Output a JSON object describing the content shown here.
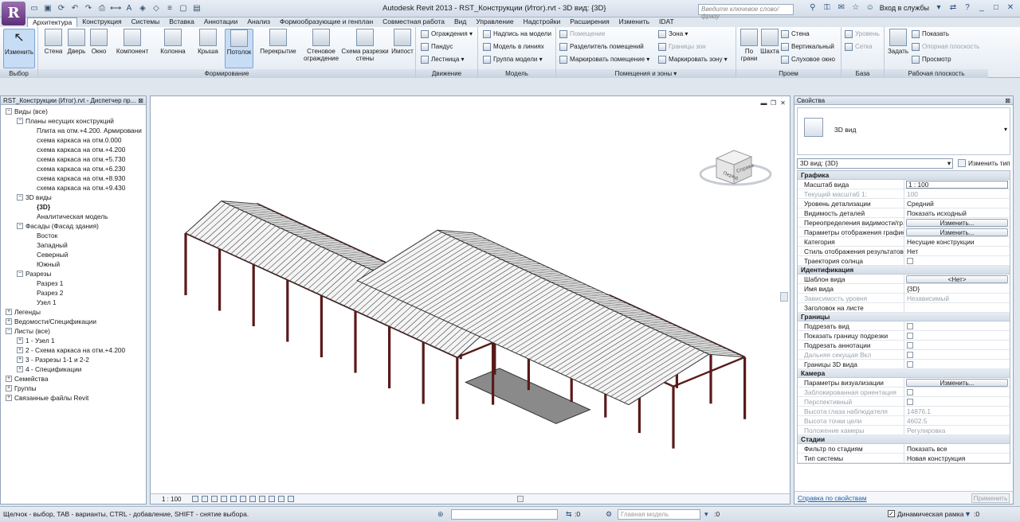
{
  "app": {
    "logo_letter": "R",
    "window_title": "Autodesk Revit 2013 -    RST_Конструкции (Итог).rvt - 3D вид: {3D}",
    "search_placeholder": "Введите ключевое слово/фразу",
    "signin": "Вход в службы"
  },
  "tabs": [
    "Архитектура",
    "Конструкция",
    "Системы",
    "Вставка",
    "Аннотации",
    "Анализ",
    "Формообразующие и генплан",
    "Совместная работа",
    "Вид",
    "Управление",
    "Надстройки",
    "Расширения",
    "Изменить",
    "IDAT"
  ],
  "ribbon": {
    "select": {
      "label": "Выбор",
      "modify": "Изменить"
    },
    "build": {
      "label": "Формирование",
      "tools": [
        "Стена",
        "Дверь",
        "Окно",
        "Компонент",
        "Колонна",
        "Крыша",
        "Потолок",
        "Перекрытие",
        "Стеновое ограждение",
        "Схема разрезки стены",
        "Импост"
      ]
    },
    "circulation": {
      "label": "Движение",
      "items": [
        "Ограждения",
        "Пандус",
        "Лестница"
      ]
    },
    "model": {
      "label": "Модель",
      "items": [
        "Надпись на модели",
        "Модель в линиях",
        "Группа модели"
      ]
    },
    "room": {
      "label": "Помещения и зоны",
      "items": [
        "Помещение",
        "Разделитель помещений",
        "Маркировать помещение",
        "Зона",
        "Границы зон",
        "Маркировать зону"
      ]
    },
    "opening": {
      "label": "Проем",
      "items": [
        "По грани",
        "Шахта",
        "Стена",
        "Вертикальный",
        "Слуховое окно"
      ]
    },
    "datum": {
      "label": "База",
      "items": [
        "Уровень",
        "Сетка"
      ]
    },
    "workplane": {
      "label": "Рабочая плоскость",
      "set": "Задать",
      "items": [
        "Показать",
        "Опорная плоскость",
        "Просмотр"
      ]
    }
  },
  "project_browser": {
    "title": "RST_Конструкции (Итог).rvt - Диспетчер пр...",
    "nodes": [
      {
        "t": "Виды (все)",
        "lvl": 0,
        "exp": "-"
      },
      {
        "t": "Планы несущих конструкций",
        "lvl": 1,
        "exp": "-"
      },
      {
        "t": "Плита на отм.+4.200. Армировани",
        "lvl": 2
      },
      {
        "t": "схема каркаса на отм.0.000",
        "lvl": 2
      },
      {
        "t": "схема каркаса на отм.+4.200",
        "lvl": 2
      },
      {
        "t": "схема каркаса на отм.+5.730",
        "lvl": 2
      },
      {
        "t": "схема каркаса на отм.+6.230",
        "lvl": 2
      },
      {
        "t": "схема каркаса на отм.+8.930",
        "lvl": 2
      },
      {
        "t": "схема каркаса на отм.+9.430",
        "lvl": 2
      },
      {
        "t": "3D виды",
        "lvl": 1,
        "exp": "-"
      },
      {
        "t": "{3D}",
        "lvl": 2,
        "bold": true
      },
      {
        "t": "Аналитическая модель",
        "lvl": 2
      },
      {
        "t": "Фасады (Фасад здания)",
        "lvl": 1,
        "exp": "-"
      },
      {
        "t": "Восток",
        "lvl": 2
      },
      {
        "t": "Западный",
        "lvl": 2
      },
      {
        "t": "Северный",
        "lvl": 2
      },
      {
        "t": "Южный",
        "lvl": 2
      },
      {
        "t": "Разрезы",
        "lvl": 1,
        "exp": "-"
      },
      {
        "t": "Разрез 1",
        "lvl": 2
      },
      {
        "t": "Разрез 2",
        "lvl": 2
      },
      {
        "t": "Узел 1",
        "lvl": 2
      },
      {
        "t": "Легенды",
        "lvl": 0,
        "exp": "+"
      },
      {
        "t": "Ведомости/Спецификации",
        "lvl": 0,
        "exp": "+"
      },
      {
        "t": "Листы (все)",
        "lvl": 0,
        "exp": "-"
      },
      {
        "t": "1 - Узел 1",
        "lvl": 1,
        "exp": "+"
      },
      {
        "t": "2 - Схема каркаса на отм.+4.200",
        "lvl": 1,
        "exp": "+"
      },
      {
        "t": "3 - Разрезы 1-1 и 2-2",
        "lvl": 1,
        "exp": "+"
      },
      {
        "t": "4 - Спецификации",
        "lvl": 1,
        "exp": "+"
      },
      {
        "t": "Семейства",
        "lvl": 0,
        "exp": "+"
      },
      {
        "t": "Группы",
        "lvl": 0,
        "exp": "+"
      },
      {
        "t": "Связанные файлы Revit",
        "lvl": 0,
        "exp": "+"
      }
    ]
  },
  "viewport": {
    "scale": "1 : 100",
    "cube_left": "Перед",
    "cube_right": "Справа"
  },
  "properties": {
    "title": "Свойства",
    "type_name": "3D вид",
    "selector": "3D вид: {3D}",
    "edit_type": "Изменить тип",
    "groups": [
      {
        "name": "Графика",
        "rows": [
          {
            "k": "Масштаб вида",
            "v": "1 : 100",
            "kind": "input"
          },
          {
            "k": "Текущий масштаб   1:",
            "v": "100",
            "dis": true
          },
          {
            "k": "Уровень детализации",
            "v": "Средний"
          },
          {
            "k": "Видимость деталей",
            "v": "Показать исходный"
          },
          {
            "k": "Переопределения видимости/гр...",
            "v": "Изменить...",
            "kind": "btn"
          },
          {
            "k": "Параметры отображения графики",
            "v": "Изменить...",
            "kind": "btn"
          },
          {
            "k": "Категория",
            "v": "Несущие конструкции"
          },
          {
            "k": "Стиль отображения результатов ...",
            "v": "Нет"
          },
          {
            "k": "Траектория солнца",
            "v": "",
            "kind": "cb"
          }
        ]
      },
      {
        "name": "Идентификация",
        "rows": [
          {
            "k": "Шаблон вида",
            "v": "<Нет>",
            "kind": "btn"
          },
          {
            "k": "Имя вида",
            "v": "{3D}"
          },
          {
            "k": "Зависимость уровня",
            "v": "Независимый",
            "dis": true
          },
          {
            "k": "Заголовок на листе",
            "v": ""
          }
        ]
      },
      {
        "name": "Границы",
        "rows": [
          {
            "k": "Подрезать вид",
            "v": "",
            "kind": "cb"
          },
          {
            "k": "Показать границу подрезки",
            "v": "",
            "kind": "cb"
          },
          {
            "k": "Подрезать аннотации",
            "v": "",
            "kind": "cb"
          },
          {
            "k": "Дальняя секущая Вкл",
            "v": "",
            "kind": "cb",
            "dis": true
          },
          {
            "k": "Границы 3D вида",
            "v": "",
            "kind": "cb"
          }
        ]
      },
      {
        "name": "Камера",
        "rows": [
          {
            "k": "Параметры визуализации",
            "v": "Изменить...",
            "kind": "btn"
          },
          {
            "k": "Заблокированная ориентация",
            "v": "",
            "kind": "cb",
            "dis": true
          },
          {
            "k": "Перспективный",
            "v": "",
            "kind": "cb",
            "dis": true
          },
          {
            "k": "Высота глаза наблюдателя",
            "v": "14876.1",
            "dis": true
          },
          {
            "k": "Высота точки цели",
            "v": "4602.5",
            "dis": true
          },
          {
            "k": "Положение камеры",
            "v": "Регулировка",
            "dis": true
          }
        ]
      },
      {
        "name": "Стадии",
        "rows": [
          {
            "k": "Фильтр по стадиям",
            "v": "Показать все"
          },
          {
            "k": "Тип системы",
            "v": "Новая конструкция"
          }
        ]
      }
    ],
    "help_link": "Справка по свойствам",
    "apply": "Применить"
  },
  "status": {
    "message": "Щелчок - выбор, TAB - варианты, CTRL - добавление, SHIFT - снятие выбора.",
    "count1": ":0",
    "count2": ":0",
    "model_placeholder": "Главная модель",
    "dynamic": "Динамическая рамка",
    "count3": ":0"
  },
  "colors": {
    "column": "#5a1a1a",
    "roof": "#2a2a2a",
    "slab": "#8a8a8a"
  }
}
